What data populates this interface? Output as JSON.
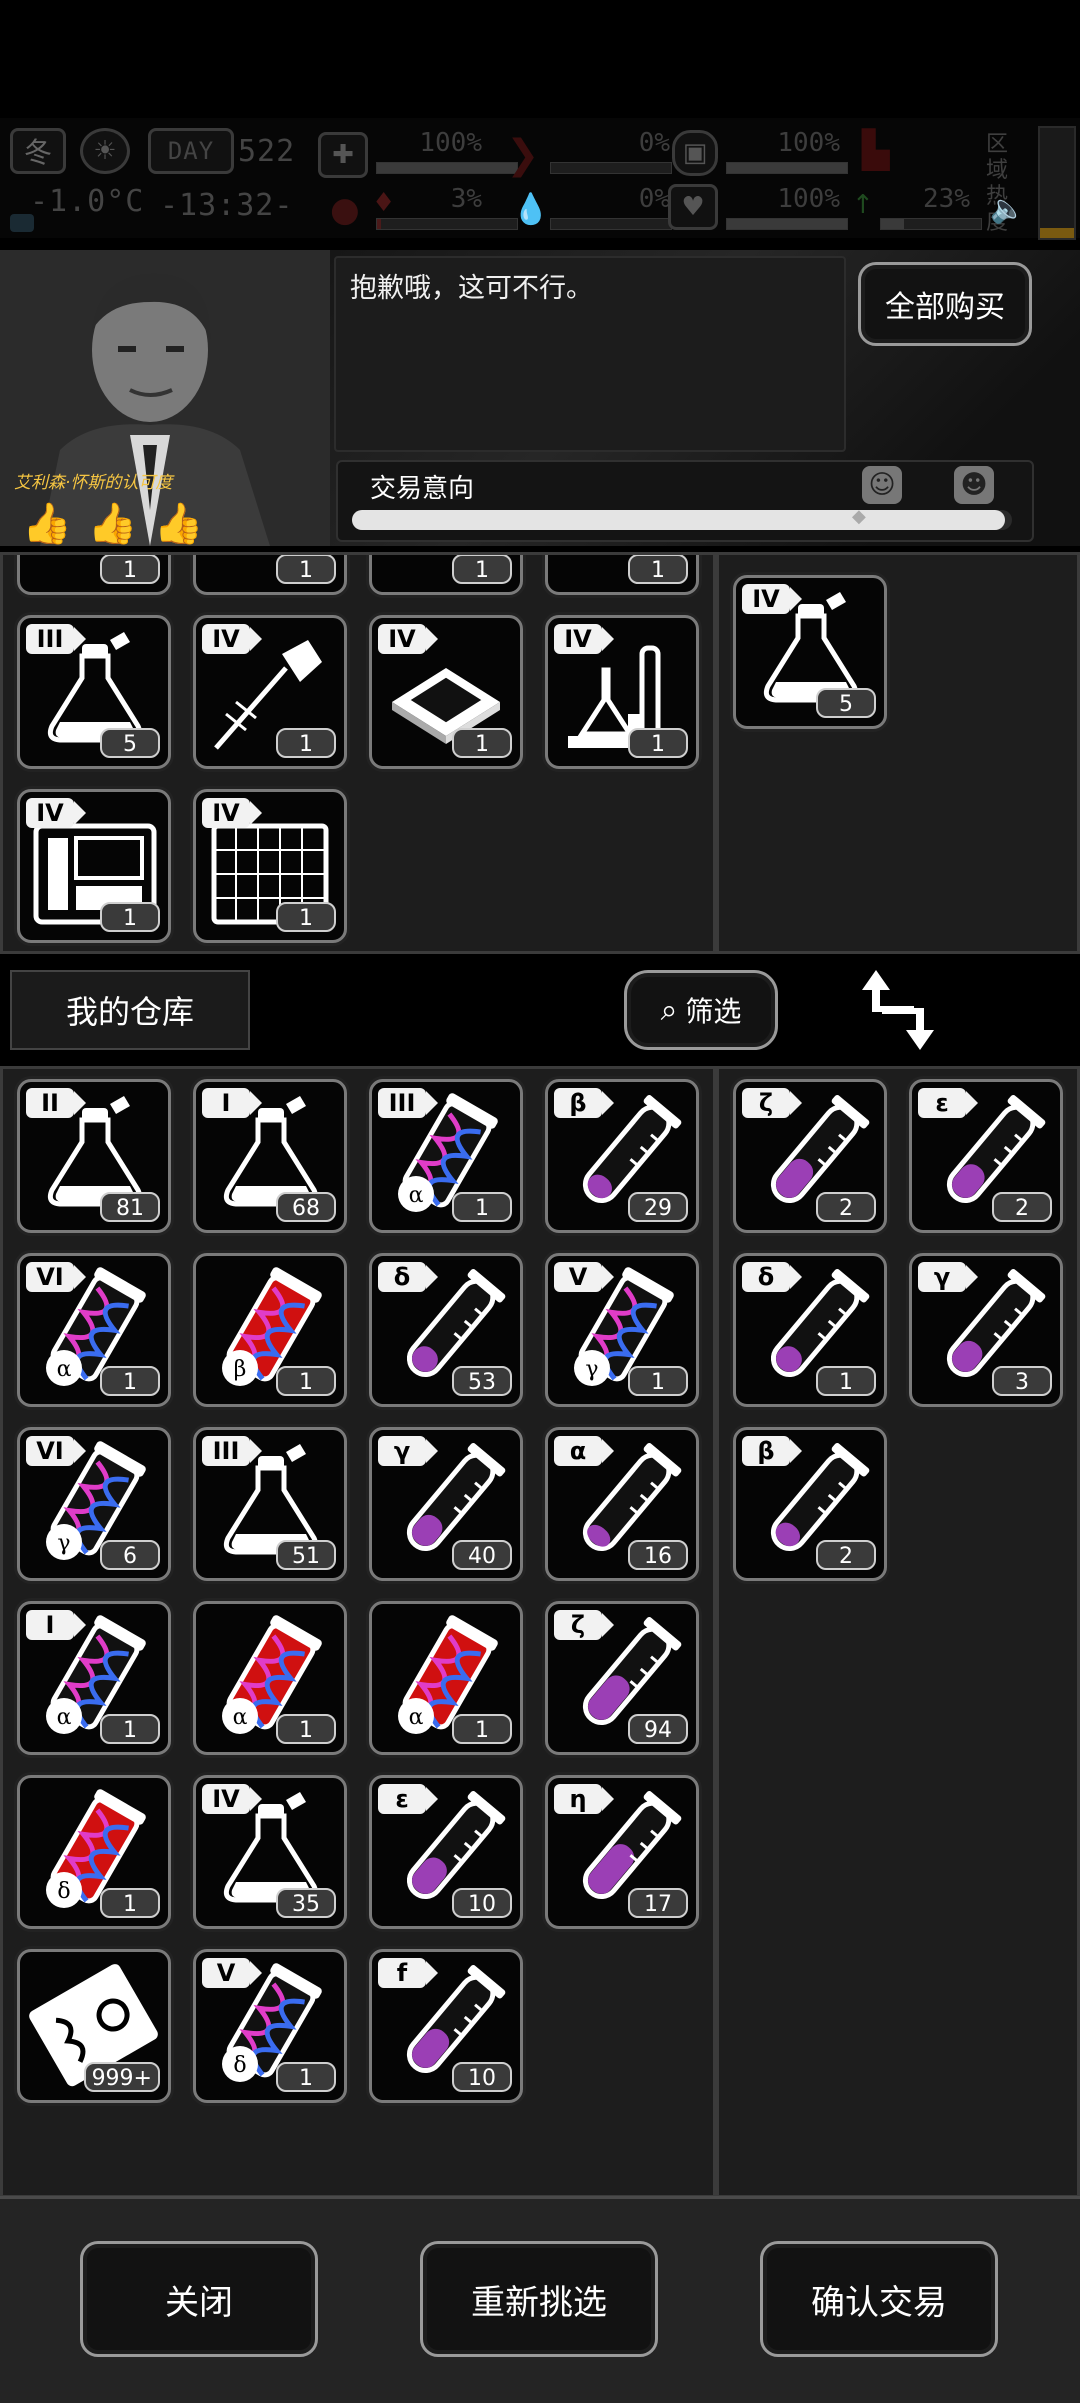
{
  "status": {
    "season": "冬",
    "day_label": "DAY",
    "day": "522",
    "temperature": "-1.0°C",
    "clock": "-13:32-",
    "health_pct": "100%",
    "hunger_pct": "0%",
    "armor_pct": "100%",
    "bleed_pct": "3%",
    "thirst_pct": "0%",
    "heart_pct": "100%",
    "stamina_pct": "23%",
    "region_heat_label": "区域热度"
  },
  "trader": {
    "name_label": "艾利森·怀斯的认可度",
    "thumbs": 3,
    "speech": "抱歉哦，这可不行。",
    "buy_all": "全部购买",
    "intent_label": "交易意向",
    "intent_level": 0.99
  },
  "trader_inventory": [
    {
      "tag": "",
      "count": "1"
    },
    {
      "tag": "",
      "count": "1"
    },
    {
      "tag": "",
      "count": "1"
    },
    {
      "tag": "",
      "count": "1"
    },
    {
      "tag": "III",
      "art": "flask",
      "count": "5"
    },
    {
      "tag": "IV",
      "art": "injector",
      "count": "1"
    },
    {
      "tag": "IV",
      "art": "chip",
      "count": "1"
    },
    {
      "tag": "IV",
      "art": "lab",
      "count": "1"
    },
    {
      "tag": "IV",
      "art": "machine",
      "count": "1"
    },
    {
      "tag": "IV",
      "art": "grid",
      "count": "1"
    }
  ],
  "trader_offer": [
    {
      "tag": "IV",
      "art": "flask",
      "count": "5"
    }
  ],
  "warehouse": {
    "title": "我的仓库",
    "filter": "筛选"
  },
  "my_inventory": [
    {
      "tag": "II",
      "art": "flask",
      "count": "81"
    },
    {
      "tag": "I",
      "art": "flask",
      "count": "68"
    },
    {
      "tag": "III",
      "art": "dna",
      "sub": "α",
      "count": "1"
    },
    {
      "tag": "β",
      "art": "tube",
      "level": 0.3,
      "count": "29"
    },
    {
      "tag": "VI",
      "art": "dna",
      "sub": "α",
      "count": "1"
    },
    {
      "tag": "",
      "art": "dna-red",
      "sub": "β",
      "count": "1"
    },
    {
      "tag": "δ",
      "art": "tube",
      "level": 0.35,
      "count": "53"
    },
    {
      "tag": "V",
      "art": "dna",
      "sub": "γ",
      "count": "1"
    },
    {
      "tag": "VI",
      "art": "dna",
      "sub": "γ",
      "count": "6"
    },
    {
      "tag": "III",
      "art": "flask",
      "count": "51"
    },
    {
      "tag": "γ",
      "art": "tube",
      "level": 0.45,
      "count": "40"
    },
    {
      "tag": "α",
      "art": "tube",
      "level": 0.25,
      "count": "16"
    },
    {
      "tag": "I",
      "art": "dna",
      "sub": "α",
      "count": "1"
    },
    {
      "tag": "",
      "art": "dna-red",
      "sub": "α",
      "count": "1"
    },
    {
      "tag": "",
      "art": "dna-red",
      "sub": "α",
      "count": "1"
    },
    {
      "tag": "ζ",
      "art": "tube",
      "level": 0.7,
      "count": "94"
    },
    {
      "tag": "",
      "art": "dna-red",
      "sub": "δ",
      "count": "1"
    },
    {
      "tag": "IV",
      "art": "flask",
      "count": "35"
    },
    {
      "tag": "ε",
      "art": "tube",
      "level": 0.55,
      "count": "10"
    },
    {
      "tag": "η",
      "art": "tube",
      "level": 0.8,
      "count": "17"
    },
    {
      "tag": "",
      "art": "manual",
      "count": "999+"
    },
    {
      "tag": "V",
      "art": "dna",
      "sub": "δ",
      "count": "1"
    },
    {
      "tag": "f",
      "art": "tube",
      "level": 0.6,
      "count": "10"
    }
  ],
  "my_offer": [
    {
      "tag": "ζ",
      "art": "tube",
      "level": 0.6,
      "count": "2"
    },
    {
      "tag": "ε",
      "art": "tube",
      "level": 0.5,
      "count": "2"
    },
    {
      "tag": "δ",
      "art": "tube",
      "level": 0.35,
      "count": "1"
    },
    {
      "tag": "γ",
      "art": "tube",
      "level": 0.45,
      "count": "3"
    },
    {
      "tag": "β",
      "art": "tube",
      "level": 0.3,
      "count": "2"
    }
  ],
  "actions": {
    "close": "关闭",
    "reselect": "重新挑选",
    "confirm": "确认交易"
  }
}
